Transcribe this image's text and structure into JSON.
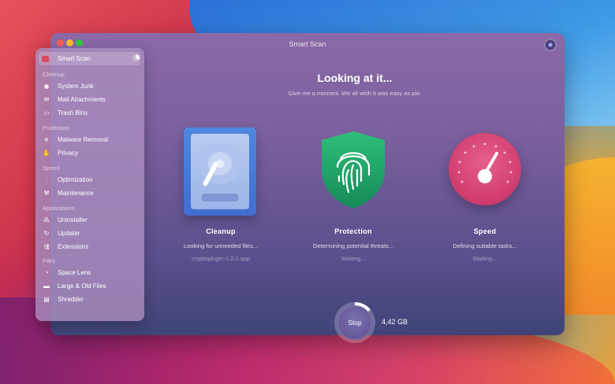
{
  "window": {
    "title": "Smart Scan"
  },
  "sidebar": {
    "active": {
      "label": "Smart Scan",
      "icon": "monitor-icon"
    },
    "sections": [
      {
        "title": "Cleanup",
        "items": [
          {
            "label": "System Junk",
            "icon": "disk-icon"
          },
          {
            "label": "Mail Attachments",
            "icon": "mail-icon"
          },
          {
            "label": "Trash Bins",
            "icon": "trash-icon"
          }
        ]
      },
      {
        "title": "Protection",
        "items": [
          {
            "label": "Malware Removal",
            "icon": "biohazard-icon"
          },
          {
            "label": "Privacy",
            "icon": "hand-icon"
          }
        ]
      },
      {
        "title": "Speed",
        "items": [
          {
            "label": "Optimization",
            "icon": "sliders-icon"
          },
          {
            "label": "Maintenance",
            "icon": "wrench-icon"
          }
        ]
      },
      {
        "title": "Applications",
        "items": [
          {
            "label": "Uninstaller",
            "icon": "apps-icon"
          },
          {
            "label": "Updater",
            "icon": "update-icon"
          },
          {
            "label": "Extensions",
            "icon": "extension-icon"
          }
        ]
      },
      {
        "title": "Files",
        "items": [
          {
            "label": "Space Lens",
            "icon": "lens-icon"
          },
          {
            "label": "Large & Old Files",
            "icon": "folder-icon"
          },
          {
            "label": "Shredder",
            "icon": "shredder-icon"
          }
        ]
      }
    ]
  },
  "main": {
    "heading": "Looking at it...",
    "subheading": "Give me a moment. We all wish it was easy as pie.",
    "columns": [
      {
        "name": "Cleanup",
        "status": "Looking for unneeded files...",
        "file": "cryptoplugin-1.2.2.app",
        "icon": "hard-drive-icon"
      },
      {
        "name": "Protection",
        "status": "Determining potential threats...",
        "file": "Waiting...",
        "icon": "fingerprint-shield-icon"
      },
      {
        "name": "Speed",
        "status": "Defining suitable tasks...",
        "file": "Waiting...",
        "icon": "speedometer-icon"
      }
    ],
    "stop_label": "Stop",
    "size": "4,42 GB",
    "progress": 0.14
  },
  "colors": {
    "accent": "#7a5f9e",
    "cleanup": "#4f88e0",
    "protection": "#1fa06a",
    "speed": "#d9437a"
  }
}
